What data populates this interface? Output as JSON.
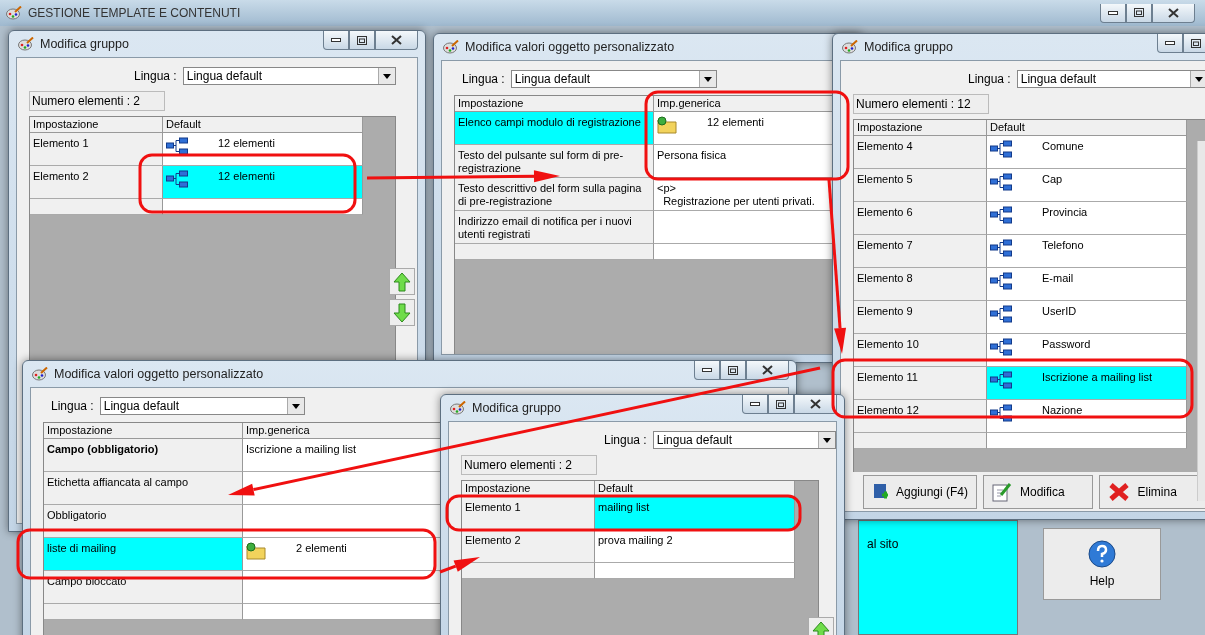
{
  "app": {
    "title": "GESTIONE TEMPLATE E CONTENUTI",
    "controls": [
      {
        "kind": "minimize"
      },
      {
        "kind": "maximize"
      },
      {
        "kind": "close"
      }
    ]
  },
  "background": {
    "text": "al sito",
    "button": "Help"
  },
  "windows": [
    {
      "title": "Modifica gruppo",
      "controls": [
        {
          "kind": "minimize"
        },
        {
          "kind": "maximize"
        },
        {
          "kind": "close"
        }
      ],
      "language_label": "Lingua :",
      "language": "Lingua default",
      "count": "Numero elementi : 2",
      "columns": [
        "Impostazione",
        "Default"
      ],
      "rows": [
        {
          "cells": [
            {
              "kind": "text",
              "text": "Elemento 1",
              "selected": false
            },
            {
              "kind": "tree",
              "text": "12 elementi",
              "selected": false
            }
          ]
        },
        {
          "cells": [
            {
              "kind": "text",
              "text": "Elemento 2",
              "selected": false
            },
            {
              "kind": "tree",
              "text": "12 elementi",
              "selected": true
            }
          ]
        },
        {
          "cells": [
            {
              "kind": "text",
              "selected": false
            },
            {
              "kind": "text",
              "selected": false
            }
          ]
        }
      ],
      "side_buttons": [
        {
          "kind": "up"
        },
        {
          "kind": "down"
        }
      ]
    },
    {
      "title": "Modifica valori oggetto personalizzato",
      "language_label": "Lingua :",
      "language": "Lingua default",
      "columns": [
        "Impostazione",
        "Imp.generica"
      ],
      "rows": [
        {
          "cells": [
            {
              "kind": "text",
              "text": "Elenco campi modulo di registrazione",
              "selected": true
            },
            {
              "kind": "folder",
              "text": "12 elementi",
              "selected": false
            }
          ]
        },
        {
          "cells": [
            {
              "kind": "text",
              "text": "Testo del pulsante sul form di pre-registrazione",
              "selected": false
            },
            {
              "kind": "text",
              "text": "Persona fisica",
              "selected": false
            }
          ]
        },
        {
          "cells": [
            {
              "kind": "text",
              "text": "Testo descrittivo del form sulla pagina di pre-registrazione",
              "selected": false
            },
            {
              "kind": "text",
              "text": "<p>\n  Registrazione per utenti privati.",
              "selected": false
            }
          ]
        },
        {
          "cells": [
            {
              "kind": "text",
              "text": "Indirizzo email di notifica per i nuovi utenti registrati",
              "selected": false
            },
            {
              "kind": "text",
              "selected": false
            }
          ]
        },
        {
          "cells": [
            {
              "kind": "text",
              "selected": false
            },
            {
              "kind": "text",
              "selected": false
            }
          ]
        }
      ]
    },
    {
      "title": "Modifica gruppo",
      "controls": [
        {
          "kind": "minimize"
        },
        {
          "kind": "maximize"
        }
      ],
      "language_label": "Lingua :",
      "language": "Lingua default",
      "count": "Numero elementi : 12",
      "columns": [
        "Impostazione",
        "Default"
      ],
      "rows": [
        {
          "cells": [
            {
              "kind": "text",
              "text": "Elemento 4",
              "selected": false
            },
            {
              "kind": "tree",
              "text": "Comune",
              "selected": false
            }
          ]
        },
        {
          "cells": [
            {
              "kind": "text",
              "text": "Elemento 5",
              "selected": false
            },
            {
              "kind": "tree",
              "text": "Cap",
              "selected": false
            }
          ]
        },
        {
          "cells": [
            {
              "kind": "text",
              "text": "Elemento 6",
              "selected": false
            },
            {
              "kind": "tree",
              "text": "Provincia",
              "selected": false
            }
          ]
        },
        {
          "cells": [
            {
              "kind": "text",
              "text": "Elemento 7",
              "selected": false
            },
            {
              "kind": "tree",
              "text": "Telefono",
              "selected": false
            }
          ]
        },
        {
          "cells": [
            {
              "kind": "text",
              "text": "Elemento 8",
              "selected": false
            },
            {
              "kind": "tree",
              "text": "E-mail",
              "selected": false
            }
          ]
        },
        {
          "cells": [
            {
              "kind": "text",
              "text": "Elemento 9",
              "selected": false
            },
            {
              "kind": "tree",
              "text": "UserID",
              "selected": false
            }
          ]
        },
        {
          "cells": [
            {
              "kind": "text",
              "text": "Elemento 10",
              "selected": false
            },
            {
              "kind": "tree",
              "text": "Password",
              "selected": false
            }
          ]
        },
        {
          "cells": [
            {
              "kind": "text",
              "text": "Elemento 11",
              "selected": false
            },
            {
              "kind": "tree",
              "text": "Iscrizione a mailing list",
              "selected": true
            }
          ]
        },
        {
          "cells": [
            {
              "kind": "text",
              "text": "Elemento 12",
              "selected": false
            },
            {
              "kind": "tree",
              "text": "Nazione",
              "selected": false
            }
          ]
        },
        {
          "cells": [
            {
              "kind": "text",
              "selected": false
            },
            {
              "kind": "text",
              "selected": false
            }
          ]
        }
      ],
      "footer_buttons": [
        {
          "kind": "add",
          "label": "Aggiungi (F4)"
        },
        {
          "kind": "edit",
          "label": "Modifica"
        },
        {
          "kind": "delete",
          "label": "Elimina"
        }
      ]
    },
    {
      "title": "Modifica valori oggetto personalizzato",
      "controls": [
        {
          "kind": "minimize"
        },
        {
          "kind": "maximize"
        },
        {
          "kind": "close"
        }
      ],
      "language_label": "Lingua :",
      "language": "Lingua default",
      "columns": [
        "Impostazione",
        "Imp.generica"
      ],
      "rows": [
        {
          "cells": [
            {
              "kind": "bold",
              "text": "Campo (obbligatorio)",
              "selected": false
            },
            {
              "kind": "text",
              "text": "Iscrizione a mailing list",
              "selected": false
            }
          ]
        },
        {
          "cells": [
            {
              "kind": "text",
              "text": "Etichetta affiancata al campo",
              "selected": false
            },
            {
              "kind": "text",
              "selected": false
            }
          ]
        },
        {
          "cells": [
            {
              "kind": "text",
              "text": "Obbligatorio",
              "selected": false
            },
            {
              "kind": "text",
              "selected": false
            }
          ]
        },
        {
          "cells": [
            {
              "kind": "text",
              "text": "liste di mailing",
              "selected": true
            },
            {
              "kind": "folder",
              "text": "2 elementi",
              "selected": false
            }
          ]
        },
        {
          "cells": [
            {
              "kind": "text",
              "text": "Campo bloccato",
              "selected": false
            },
            {
              "kind": "text",
              "selected": false
            }
          ]
        },
        {
          "cells": [
            {
              "kind": "text",
              "selected": false
            },
            {
              "kind": "text",
              "selected": false
            }
          ]
        }
      ]
    },
    {
      "title": "Modifica gruppo",
      "controls": [
        {
          "kind": "minimize"
        },
        {
          "kind": "maximize"
        },
        {
          "kind": "close"
        }
      ],
      "language_label": "Lingua :",
      "language": "Lingua default",
      "count": "Numero elementi : 2",
      "columns": [
        "Impostazione",
        "Default"
      ],
      "rows": [
        {
          "cells": [
            {
              "kind": "text",
              "text": "Elemento 1",
              "selected": false
            },
            {
              "kind": "text",
              "text": "mailing list",
              "selected": true
            }
          ]
        },
        {
          "cells": [
            {
              "kind": "text",
              "text": "Elemento 2",
              "selected": false
            },
            {
              "kind": "text",
              "text": "prova mailing 2",
              "selected": false
            }
          ]
        },
        {
          "cells": [
            {
              "kind": "text",
              "selected": false
            },
            {
              "kind": "text",
              "selected": false
            }
          ]
        }
      ],
      "side_buttons": [
        {
          "kind": "up"
        }
      ]
    }
  ]
}
